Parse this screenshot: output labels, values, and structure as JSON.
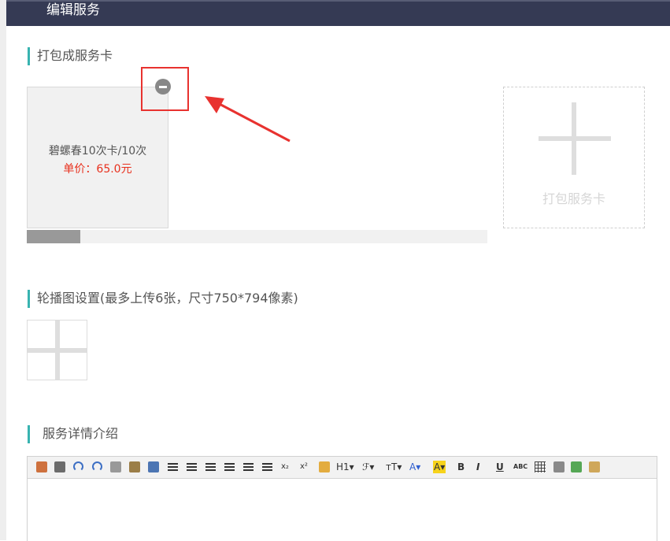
{
  "header": {
    "title": "编辑服务"
  },
  "sections": {
    "pack": {
      "title": "打包成服务卡"
    },
    "carousel": {
      "title": "轮播图设置(最多上传6张，尺寸750*794像素)"
    },
    "detail": {
      "title": "服务详情介绍"
    }
  },
  "service_card": {
    "name": "碧螺春10次卡/10次",
    "price": "单价：65.0元"
  },
  "add_card": {
    "label": "打包服务卡"
  },
  "scrollbar": {
    "position": 0.0
  },
  "colors": {
    "header_bg": "#353a54",
    "accent": "#38b3b0",
    "price": "#e8301d",
    "highlight": "#e8322f"
  },
  "toolbar": {
    "items": [
      {
        "name": "insert-image-icon",
        "text": ""
      },
      {
        "name": "file-icon",
        "text": ""
      },
      {
        "name": "undo-icon",
        "text": ""
      },
      {
        "name": "redo-icon",
        "text": ""
      },
      {
        "name": "preview-icon",
        "text": ""
      },
      {
        "name": "paste-icon",
        "text": ""
      },
      {
        "name": "paste-word-icon",
        "text": ""
      },
      {
        "name": "align-left-icon",
        "text": ""
      },
      {
        "name": "align-center-icon",
        "text": ""
      },
      {
        "name": "align-right-icon",
        "text": ""
      },
      {
        "name": "align-justify-icon",
        "text": ""
      },
      {
        "name": "ordered-list-icon",
        "text": ""
      },
      {
        "name": "unordered-list-icon",
        "text": ""
      },
      {
        "name": "subscript-button",
        "text": "x₂"
      },
      {
        "name": "superscript-button",
        "text": "x²"
      },
      {
        "name": "clear-format-icon",
        "text": ""
      },
      {
        "name": "heading-button",
        "text": "H1▾"
      },
      {
        "name": "font-family-button",
        "text": "ℱ▾"
      },
      {
        "name": "font-size-button",
        "text": "ᴛT▾"
      },
      {
        "name": "font-color-button",
        "text": "A▾"
      },
      {
        "name": "highlight-color-button",
        "text": "A▾"
      },
      {
        "name": "bold-button",
        "text": "B"
      },
      {
        "name": "italic-button",
        "text": "I"
      },
      {
        "name": "underline-button",
        "text": "U"
      },
      {
        "name": "strikethrough-button",
        "text": "ABC"
      },
      {
        "name": "table-icon",
        "text": ""
      },
      {
        "name": "eraser-icon",
        "text": ""
      },
      {
        "name": "insert-below-icon",
        "text": ""
      },
      {
        "name": "source-icon",
        "text": ""
      }
    ]
  }
}
